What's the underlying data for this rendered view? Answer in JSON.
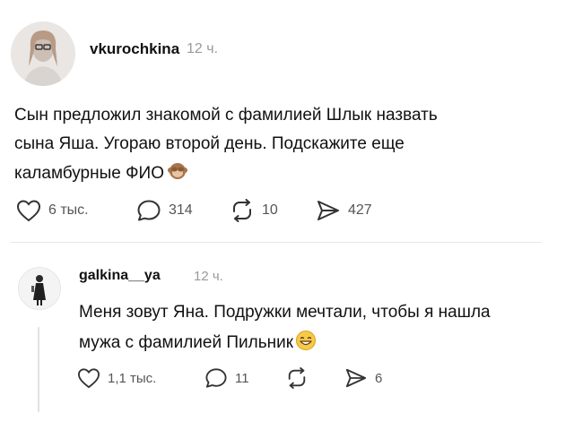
{
  "post": {
    "username": "vkurochkina",
    "time": "12 ч.",
    "text_line1": "Сын предложил знакомой с фамилией Шлык назвать",
    "text_line2": "сына Яша. Угораю второй день. Подскажите еще",
    "text_line3": "каламбурные ФИО",
    "emoji": "see-no-evil-monkey-emoji",
    "likes": "6 тыс.",
    "comments": "314",
    "reposts": "10",
    "shares": "427"
  },
  "reply": {
    "username": "galkina__ya",
    "time": "12 ч.",
    "text_line1": "Меня зовут Яна. Подружки мечтали, чтобы я нашла",
    "text_line2": "мужа с фамилией Пильник",
    "emoji": "grinning-face-emoji",
    "likes": "1,1 тыс.",
    "comments": "11",
    "shares": "6"
  },
  "icons": {
    "like": "heart-icon",
    "comment": "comment-bubble-icon",
    "repost": "repost-arrows-icon",
    "share": "send-arrow-icon"
  }
}
